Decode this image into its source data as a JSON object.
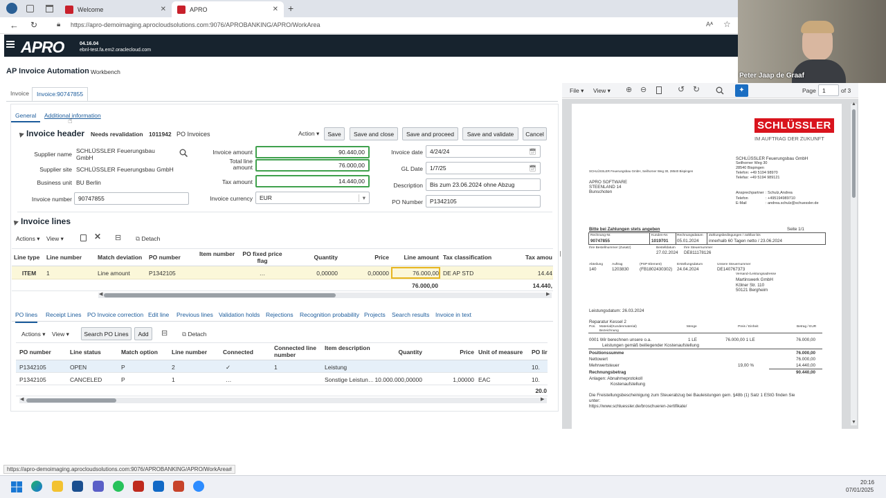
{
  "browser": {
    "tabs": [
      {
        "label": "Welcome"
      },
      {
        "label": "APRO"
      }
    ],
    "url": "https://apro-demoimaging.aprocloudsolutions.com:9076/APROBANKING/APRO/WorkArea",
    "reader_icon": "Aᴬ",
    "status_url": "https://apro-demoimaging.aprocloudsolutions.com:9076/APROBANKING/APRO/WorkArea#"
  },
  "app": {
    "logo": "APRO",
    "version": "04.16.04",
    "host": "ebnl-test.fa.em2.oraclecloud.com",
    "title": "AP Invoice Automation",
    "subtitle": "Workbench",
    "tabs": [
      "Invoice",
      "Invoice:90747855"
    ],
    "subtabs": [
      "General",
      "Additional information"
    ]
  },
  "header": {
    "section_title": "Invoice header",
    "status": "Needs revalidation",
    "number": "1011942",
    "type": "PO Invoices",
    "action_label": "Action",
    "buttons": {
      "save": "Save",
      "save_close": "Save and close",
      "save_proceed": "Save and proceed",
      "save_validate": "Save and validate",
      "cancel": "Cancel"
    },
    "supplier_name_label": "Supplier name",
    "supplier_name": "SCHLÜSSLER Feuerungsbau GmbH",
    "supplier_site_label": "Supplier site",
    "supplier_site": "SCHLÜSSLER Feuerungsbau GmbH",
    "business_unit_label": "Business unit",
    "business_unit": "BU Berlin",
    "invoice_number_label": "Invoice number",
    "invoice_number": "90747855",
    "invoice_amount_label": "Invoice amount",
    "invoice_amount": "90.440,00",
    "total_line_amount_label": "Total line amount",
    "total_line_amount": "76.000,00",
    "tax_amount_label": "Tax amount",
    "tax_amount": "14.440,00",
    "invoice_currency_label": "Invoice currency",
    "invoice_currency": "EUR",
    "invoice_date_label": "Invoice date",
    "invoice_date": "4/24/24",
    "gl_date_label": "GL Date",
    "gl_date": "1/7/25",
    "description_label": "Description",
    "description": "Bis zum 23.06.2024 ohne Abzug",
    "po_number_label": "PO Number",
    "po_number": "P1342105"
  },
  "lines": {
    "section_title": "Invoice lines",
    "actions_label": "Actions",
    "view_label": "View",
    "detach_label": "Detach",
    "columns": [
      "Line type",
      "Line number",
      "Match deviation",
      "PO number",
      "Item number",
      "PO fixed price flag",
      "Quantity",
      "Price",
      "Line amount",
      "Tax classification",
      "Tax amou"
    ],
    "rows": [
      {
        "line_type": "ITEM",
        "line_number": "1",
        "match_deviation": "Line amount",
        "po_number": "P1342105",
        "item_number": "",
        "fixed_flag": "…",
        "quantity": "0,00000",
        "price": "0,00000",
        "line_amount": "76.000,00",
        "tax_class": "DE AP STD",
        "tax_amount": "14.44"
      }
    ],
    "total_line_amount": "76.000,00",
    "total_tax_amount": "14.440,"
  },
  "bottom": {
    "tabs": [
      "PO lines",
      "Receipt Lines",
      "PO Invoice correction",
      "Edit line",
      "Previous lines",
      "Validation holds",
      "Rejections",
      "Recognition probability",
      "Projects",
      "Search results",
      "Invoice in text"
    ],
    "actions_label": "Actions",
    "view_label": "View",
    "search_po_label": "Search PO Lines",
    "add_label": "Add",
    "detach_label": "Detach",
    "columns": [
      "PO number",
      "Line status",
      "Match option",
      "Line number",
      "Connected",
      "Connected line number",
      "Item description",
      "Quantity",
      "Price",
      "Unit of measure",
      "PO lir"
    ],
    "rows": [
      {
        "po": "P1342105",
        "status": "OPEN",
        "match": "P",
        "line": "2",
        "connected": "✓",
        "conn_line": "1",
        "desc": "Leistung",
        "qty": "",
        "price": "",
        "uom": "",
        "extra": "10."
      },
      {
        "po": "P1342105",
        "status": "CANCELED",
        "match": "P",
        "line": "1",
        "connected": "…",
        "conn_line": "",
        "desc": "Sonstige Leistun…",
        "qty": "10.000.000,00000",
        "price": "1,00000",
        "uom": "EAC",
        "extra": "10."
      }
    ],
    "total": "20.0"
  },
  "pdf": {
    "file_label": "File",
    "view_label": "View",
    "page_label": "Page",
    "page": "1",
    "of": "of 3",
    "brand": "SCHLÜSSLER",
    "tagline": "IM AUFTRAG DER ZUKUNFT",
    "sender_line": "SCHLÜSSLER Feuerungsbau GmbH, Seilhorner Weg 30, 28540 Bispingen",
    "company_lines": [
      "SCHLÜSSLER Feuerungsbau GmbH",
      "Seilhorner Weg 30",
      "28540 Bispingen",
      "Telefon: +49 5194 98970",
      "Telefax: +49 5194 989121"
    ],
    "recipient": [
      "APRO SOFTWARE",
      "STEENLAND 14",
      "Bunschoten"
    ],
    "contact_labels": [
      "Ansprechpartner",
      "Telefon",
      "E-Mail"
    ],
    "contact_values": [
      ": Schulz,Andrea",
      ": +495194989710",
      ": andrea.schulz@schuessler.de"
    ],
    "pay_note": "Bitte bei Zahlungen stets angeben",
    "page_no": "Seite 1/1",
    "box_headers": [
      "Rechnung-Nr.",
      "Kunden-Nr.",
      "Rechnungsdatum",
      "Zahlungsbedingungen / zahlbar bis"
    ],
    "box_values": [
      "90747855",
      "1019701",
      "05.01.2024",
      "innerhalb 60 Tagen netto / 23.06.2024"
    ],
    "order_labels": [
      "Ihre Bestellnummer (Zusatz)",
      "Bestelldatum",
      "Ihre Steuernummer"
    ],
    "order_values": [
      "27.02.2024",
      "DE811178126"
    ],
    "ref_labels": [
      "Abteilung",
      "Auftrag",
      "(PSP-Element)",
      "Erstellungsdatum",
      "Unsere Steuernummer"
    ],
    "ref_values": [
      "140",
      "1203830",
      "(FB1802430302)",
      "24.04.2024",
      "DE140767373"
    ],
    "delivery_title": "Versand-/Leistungsadresse",
    "delivery": [
      "Martinswerk GmbH",
      "Kölner Str. 110",
      "50121 Bergheim"
    ],
    "service_date": "Leistungsdatum: 26.03.2024",
    "repair": "Reparatur Kessel 2",
    "item_headers": [
      "Pos.",
      "Material(Kundenmaterial)",
      "Bezeichnung",
      "Menge",
      "Preis / Einheit",
      "Betrag / EUR"
    ],
    "item_line": "0001 Wir berechnen unsere o.a.",
    "item_qty": "1   LE",
    "item_price": "76.000,00     1   LE",
    "item_total": "76.000,00",
    "item_desc": "Leistungen gemäß beiliegender Kostenaufstellung",
    "sum_labels": [
      "Positionssumme",
      "Nettowert",
      "Mehrwertsteuer",
      "Rechnungsbetrag"
    ],
    "sum_values": [
      "76.000,00",
      "76.000,00",
      "14.440,00",
      "90.440,00"
    ],
    "vat_rate": "19,00   %",
    "attachments": "Anlagen:  Abnahmeprotokoll",
    "attachments2": "Kostenaufstellung",
    "footer1": "Die Freistellungsbescheinigung zum Steuerabzug bei Bauleistungen gem. §48b (1) Satz 1 EStG finden Sie",
    "footer2": "unter:",
    "footer3": "https://www.schluessler.de/broschueren-zertifikate/"
  },
  "webcam": {
    "name": "Peter Jaap de Graaf"
  },
  "taskbar": {
    "time": "20:16",
    "date": "07/01/2025"
  },
  "colors": {
    "appbar": "#17232e",
    "accent": "#1b5b9b",
    "highlight": "#3ea04c",
    "brand_red": "#d9141d"
  }
}
